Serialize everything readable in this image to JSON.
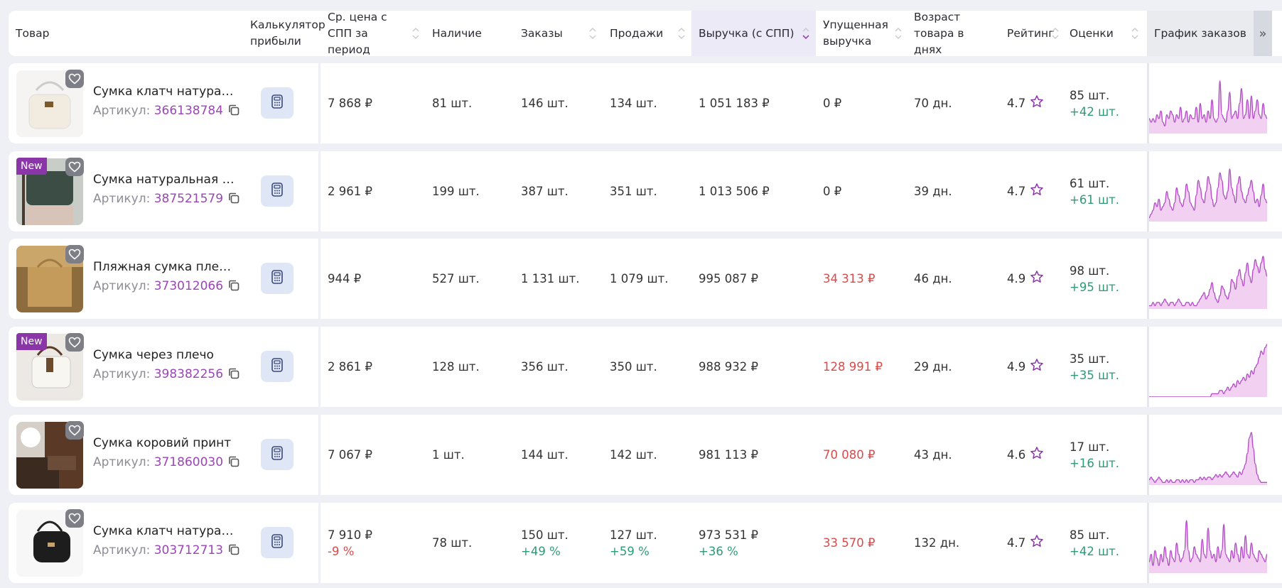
{
  "header": {
    "product": "Товар",
    "calculator": "Калькулятор прибыли",
    "avg_price": "Ср. цена с СПП за период",
    "stock": "Наличие",
    "orders": "Заказы",
    "sales": "Продажи",
    "revenue": "Выручка (с СПП)",
    "lost_revenue": "Упущенная выручка",
    "age": "Возраст товара в днях",
    "rating": "Рейтинг",
    "reviews": "Оценки",
    "chart": "График заказов",
    "collapse": "»"
  },
  "article_label": "Артикул:",
  "new_badge": "New",
  "colors": {
    "accent": "#9a46b6",
    "red": "#d64c4c",
    "green": "#2f9a77",
    "chart_line": "#b44ec8",
    "chart_fill": "#f1d0f2"
  },
  "rows": [
    {
      "name": "Сумка клатч натуральная кожа",
      "article": "366138784",
      "is_new": false,
      "avg_price": "7 868 ₽",
      "avg_price_delta": "",
      "stock": "81 шт.",
      "orders": "146 шт.",
      "orders_delta": "",
      "sales": "134 шт.",
      "sales_delta": "",
      "revenue": "1 051 183 ₽",
      "revenue_delta": "",
      "lost": "0 ₽",
      "lost_red": false,
      "age": "70 дн.",
      "rating": "4.7",
      "reviews": "85 шт.",
      "reviews_delta": "+42 шт.",
      "orders_chart": [
        4,
        3,
        4,
        3,
        5,
        4,
        6,
        3,
        2,
        5,
        4,
        6,
        5,
        3,
        5,
        4,
        7,
        3,
        4,
        6,
        3,
        5,
        4,
        4,
        7,
        3,
        8,
        4,
        5,
        3,
        6,
        4,
        9,
        4,
        3,
        4,
        14,
        5,
        4,
        3,
        6,
        11,
        4,
        5,
        6,
        4,
        8,
        12,
        4,
        5,
        9,
        4,
        10,
        4,
        6,
        9,
        5,
        4,
        8,
        5,
        4
      ]
    },
    {
      "name": "Сумка натуральная кожа",
      "article": "387521579",
      "is_new": true,
      "avg_price": "2 961 ₽",
      "avg_price_delta": "",
      "stock": "199 шт.",
      "orders": "387 шт.",
      "orders_delta": "",
      "sales": "351 шт.",
      "sales_delta": "",
      "revenue": "1 013 506 ₽",
      "revenue_delta": "",
      "lost": "0 ₽",
      "lost_red": false,
      "age": "39 дн.",
      "rating": "4.7",
      "reviews": "61 шт.",
      "reviews_delta": "+61 шт.",
      "orders_chart": [
        1,
        2,
        3,
        5,
        4,
        6,
        3,
        4,
        5,
        8,
        6,
        4,
        3,
        5,
        9,
        7,
        5,
        4,
        6,
        10,
        8,
        5,
        4,
        3,
        7,
        11,
        9,
        6,
        5,
        8,
        12,
        10,
        6,
        4,
        5,
        9,
        13,
        11,
        7,
        6,
        8,
        14,
        9,
        7,
        5,
        10,
        12,
        8,
        6,
        5,
        7,
        9,
        11,
        8,
        5,
        6,
        4,
        7,
        10,
        6,
        5
      ]
    },
    {
      "name": "Пляжная сумка плетеная",
      "article": "373012066",
      "is_new": false,
      "avg_price": "944 ₽",
      "avg_price_delta": "",
      "stock": "527 шт.",
      "orders": "1 131 шт.",
      "orders_delta": "",
      "sales": "1 079 шт.",
      "sales_delta": "",
      "revenue": "995 087 ₽",
      "revenue_delta": "",
      "lost": "34 313 ₽",
      "lost_red": true,
      "age": "46 дн.",
      "rating": "4.9",
      "reviews": "98 шт.",
      "reviews_delta": "+95 шт.",
      "orders_chart": [
        1,
        1,
        2,
        1,
        2,
        2,
        1,
        2,
        3,
        2,
        1,
        2,
        2,
        1,
        2,
        3,
        2,
        1,
        1,
        2,
        2,
        1,
        2,
        1,
        1,
        2,
        3,
        4,
        5,
        3,
        4,
        6,
        8,
        5,
        3,
        2,
        4,
        7,
        6,
        4,
        3,
        5,
        9,
        8,
        6,
        10,
        12,
        9,
        7,
        11,
        14,
        10,
        8,
        12,
        15,
        13,
        11,
        14,
        16,
        12,
        10
      ]
    },
    {
      "name": "Сумка через плечо",
      "article": "398382256",
      "is_new": true,
      "avg_price": "2 861 ₽",
      "avg_price_delta": "",
      "stock": "128 шт.",
      "orders": "356 шт.",
      "orders_delta": "",
      "sales": "350 шт.",
      "sales_delta": "",
      "revenue": "988 932 ₽",
      "revenue_delta": "",
      "lost": "128 991 ₽",
      "lost_red": true,
      "age": "29 дн.",
      "rating": "4.9",
      "reviews": "35 шт.",
      "reviews_delta": "+35 шт.",
      "orders_chart": [
        0,
        0,
        0,
        0,
        0,
        0,
        0,
        0,
        0,
        0,
        0,
        0,
        0,
        0,
        0,
        0,
        0,
        0,
        0,
        0,
        0,
        0,
        0,
        0,
        0,
        0,
        0,
        0,
        0,
        0,
        0,
        0,
        1,
        1,
        1,
        1,
        2,
        2,
        1,
        2,
        3,
        2,
        3,
        4,
        3,
        5,
        4,
        5,
        6,
        5,
        7,
        6,
        8,
        7,
        9,
        10,
        12,
        14,
        13,
        15,
        16
      ]
    },
    {
      "name": "Сумка коровий принт",
      "article": "371860030",
      "is_new": false,
      "avg_price": "7 067 ₽",
      "avg_price_delta": "",
      "stock": "1 шт.",
      "orders": "144 шт.",
      "orders_delta": "",
      "sales": "142 шт.",
      "sales_delta": "",
      "revenue": "981 113 ₽",
      "revenue_delta": "",
      "lost": "70 080 ₽",
      "lost_red": true,
      "age": "43 дн.",
      "rating": "4.6",
      "reviews": "17 шт.",
      "reviews_delta": "+16 шт.",
      "orders_chart": [
        2,
        3,
        2,
        1,
        2,
        3,
        2,
        1,
        1,
        2,
        1,
        2,
        1,
        1,
        2,
        2,
        1,
        2,
        1,
        2,
        1,
        2,
        2,
        1,
        2,
        2,
        3,
        2,
        3,
        2,
        3,
        3,
        2,
        3,
        4,
        3,
        4,
        3,
        4,
        5,
        4,
        3,
        4,
        5,
        4,
        3,
        5,
        4,
        6,
        8,
        12,
        18,
        20,
        14,
        8,
        4,
        2,
        1,
        1,
        1,
        1
      ]
    },
    {
      "name": "Сумка клатч натуральная кожа",
      "article": "303712713",
      "is_new": false,
      "avg_price": "7 910 ₽",
      "avg_price_delta": "-9 %",
      "stock": "78 шт.",
      "orders": "150 шт.",
      "orders_delta": "+49 %",
      "sales": "127 шт.",
      "sales_delta": "+59 %",
      "revenue": "973 531 ₽",
      "revenue_delta": "+36 %",
      "lost": "33 570 ₽",
      "lost_red": true,
      "age": "132 дн.",
      "rating": "4.7",
      "reviews": "85 шт.",
      "reviews_delta": "+42 шт.",
      "orders_chart": [
        3,
        5,
        2,
        6,
        4,
        2,
        5,
        3,
        7,
        4,
        2,
        6,
        4,
        3,
        8,
        5,
        3,
        4,
        6,
        14,
        6,
        3,
        4,
        7,
        5,
        4,
        3,
        9,
        5,
        4,
        12,
        6,
        4,
        5,
        3,
        7,
        4,
        6,
        13,
        5,
        4,
        3,
        6,
        4,
        8,
        5,
        3,
        7,
        4,
        10,
        5,
        4,
        8,
        5,
        4,
        3,
        6,
        5,
        4,
        3,
        5
      ]
    }
  ]
}
